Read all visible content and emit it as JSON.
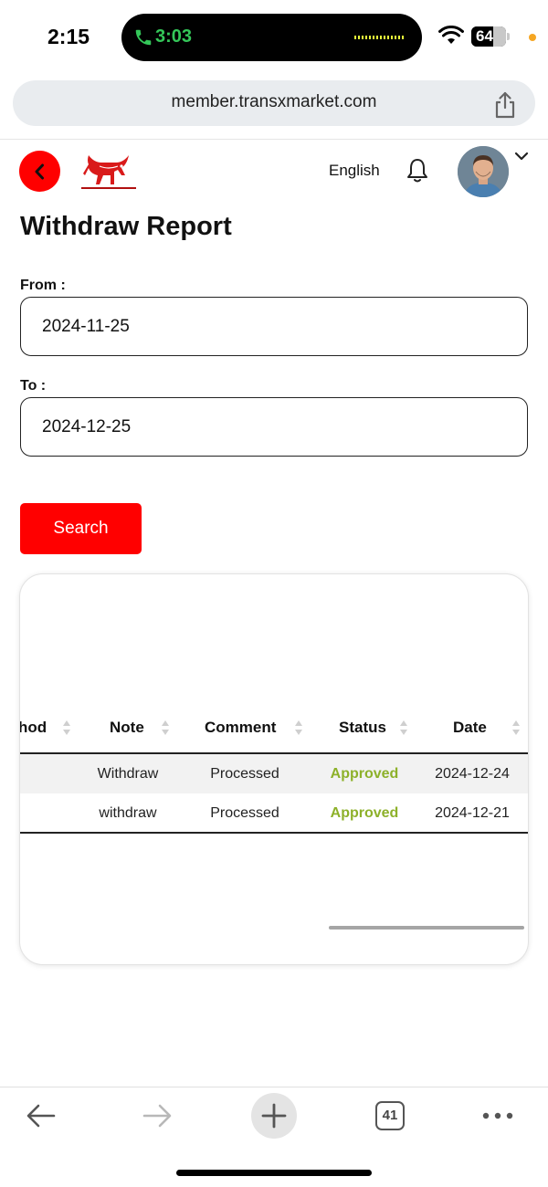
{
  "status_bar": {
    "time": "2:15",
    "call_duration": "3:03",
    "battery_percent": "64",
    "battery_level": 0.64
  },
  "browser": {
    "url": "member.transxmarket.com",
    "tab_count": "41"
  },
  "header": {
    "language": "English"
  },
  "page": {
    "title": "Withdraw Report"
  },
  "filters": {
    "from_label": "From :",
    "from_value": "2024-11-25",
    "to_label": "To :",
    "to_value": "2024-12-25",
    "search_label": "Search"
  },
  "table": {
    "columns": [
      "hod",
      "Note",
      "Comment",
      "Status",
      "Date"
    ],
    "rows": [
      {
        "method": "",
        "note": "Withdraw",
        "comment": "Processed",
        "status": "Approved",
        "date": "2024-12-24"
      },
      {
        "method": "",
        "note": "withdraw",
        "comment": "Processed",
        "status": "Approved",
        "date": "2024-12-21"
      }
    ]
  },
  "colors": {
    "accent": "#ff0000",
    "approved": "#8db12a",
    "call_green": "#34c759"
  }
}
